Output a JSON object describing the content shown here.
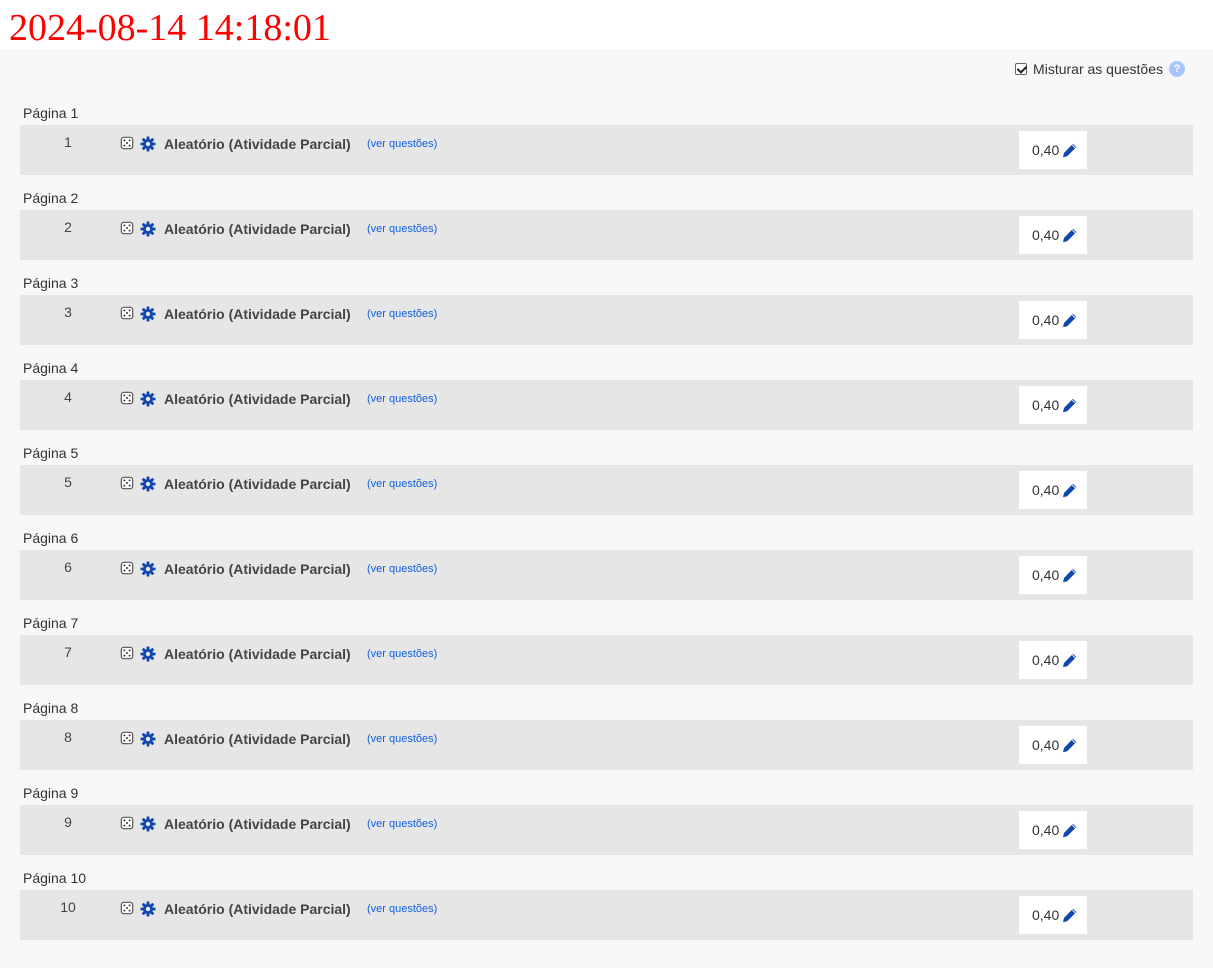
{
  "timestamp": "2024-08-14 14:18:01",
  "shuffle": {
    "label": "Misturar as questões",
    "checked": true,
    "help_glyph": "?"
  },
  "colors": {
    "link": "#1060e0",
    "icon_blue": "#0f47ad",
    "row_bg": "#e6e6e6",
    "timestamp": "#ff0000"
  },
  "icons": {
    "random": "dice-icon",
    "settings": "gear-icon",
    "edit": "pencil-icon",
    "help": "question-circle-icon"
  },
  "pages": [
    {
      "page_label": "Página 1",
      "number": "1",
      "title": "Aleatório (Atividade Parcial)",
      "link": "(ver questões)",
      "mark": "0,40"
    },
    {
      "page_label": "Página 2",
      "number": "2",
      "title": "Aleatório (Atividade Parcial)",
      "link": "(ver questões)",
      "mark": "0,40"
    },
    {
      "page_label": "Página 3",
      "number": "3",
      "title": "Aleatório (Atividade Parcial)",
      "link": "(ver questões)",
      "mark": "0,40"
    },
    {
      "page_label": "Página 4",
      "number": "4",
      "title": "Aleatório (Atividade Parcial)",
      "link": "(ver questões)",
      "mark": "0,40"
    },
    {
      "page_label": "Página 5",
      "number": "5",
      "title": "Aleatório (Atividade Parcial)",
      "link": "(ver questões)",
      "mark": "0,40"
    },
    {
      "page_label": "Página 6",
      "number": "6",
      "title": "Aleatório (Atividade Parcial)",
      "link": "(ver questões)",
      "mark": "0,40"
    },
    {
      "page_label": "Página 7",
      "number": "7",
      "title": "Aleatório (Atividade Parcial)",
      "link": "(ver questões)",
      "mark": "0,40"
    },
    {
      "page_label": "Página 8",
      "number": "8",
      "title": "Aleatório (Atividade Parcial)",
      "link": "(ver questões)",
      "mark": "0,40"
    },
    {
      "page_label": "Página 9",
      "number": "9",
      "title": "Aleatório (Atividade Parcial)",
      "link": "(ver questões)",
      "mark": "0,40"
    },
    {
      "page_label": "Página 10",
      "number": "10",
      "title": "Aleatório (Atividade Parcial)",
      "link": "(ver questões)",
      "mark": "0,40"
    }
  ]
}
